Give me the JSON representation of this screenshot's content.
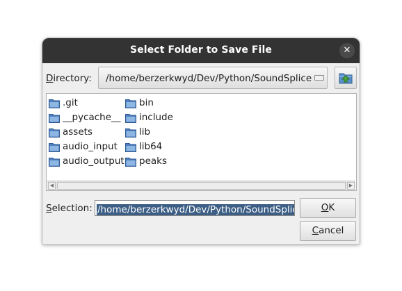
{
  "dialog": {
    "title": "Select Folder to Save File",
    "close_glyph": "✕"
  },
  "directory": {
    "label_accel": "D",
    "label_rest": "irectory:",
    "value": "/home/berzerkwyd/Dev/Python/SoundSplice",
    "up_icon": "folder-up-icon"
  },
  "files": {
    "col1": [
      ".git",
      "__pycache__",
      "assets",
      "audio_input",
      "audio_output"
    ],
    "col2": [
      "bin",
      "include",
      "lib",
      "lib64",
      "peaks"
    ],
    "scroll_left_glyph": "◀",
    "scroll_right_glyph": "▶"
  },
  "selection": {
    "label_accel": "S",
    "label_rest": "election:",
    "value": "/home/berzerkwyd/Dev/Python/SoundSplice"
  },
  "buttons": {
    "ok_accel": "O",
    "ok_rest": "K",
    "cancel_accel": "C",
    "cancel_rest": "ancel"
  },
  "colors": {
    "titlebar": "#333333",
    "selection_highlight": "#3d5f85",
    "folder_blue": "#4f7fbf"
  }
}
